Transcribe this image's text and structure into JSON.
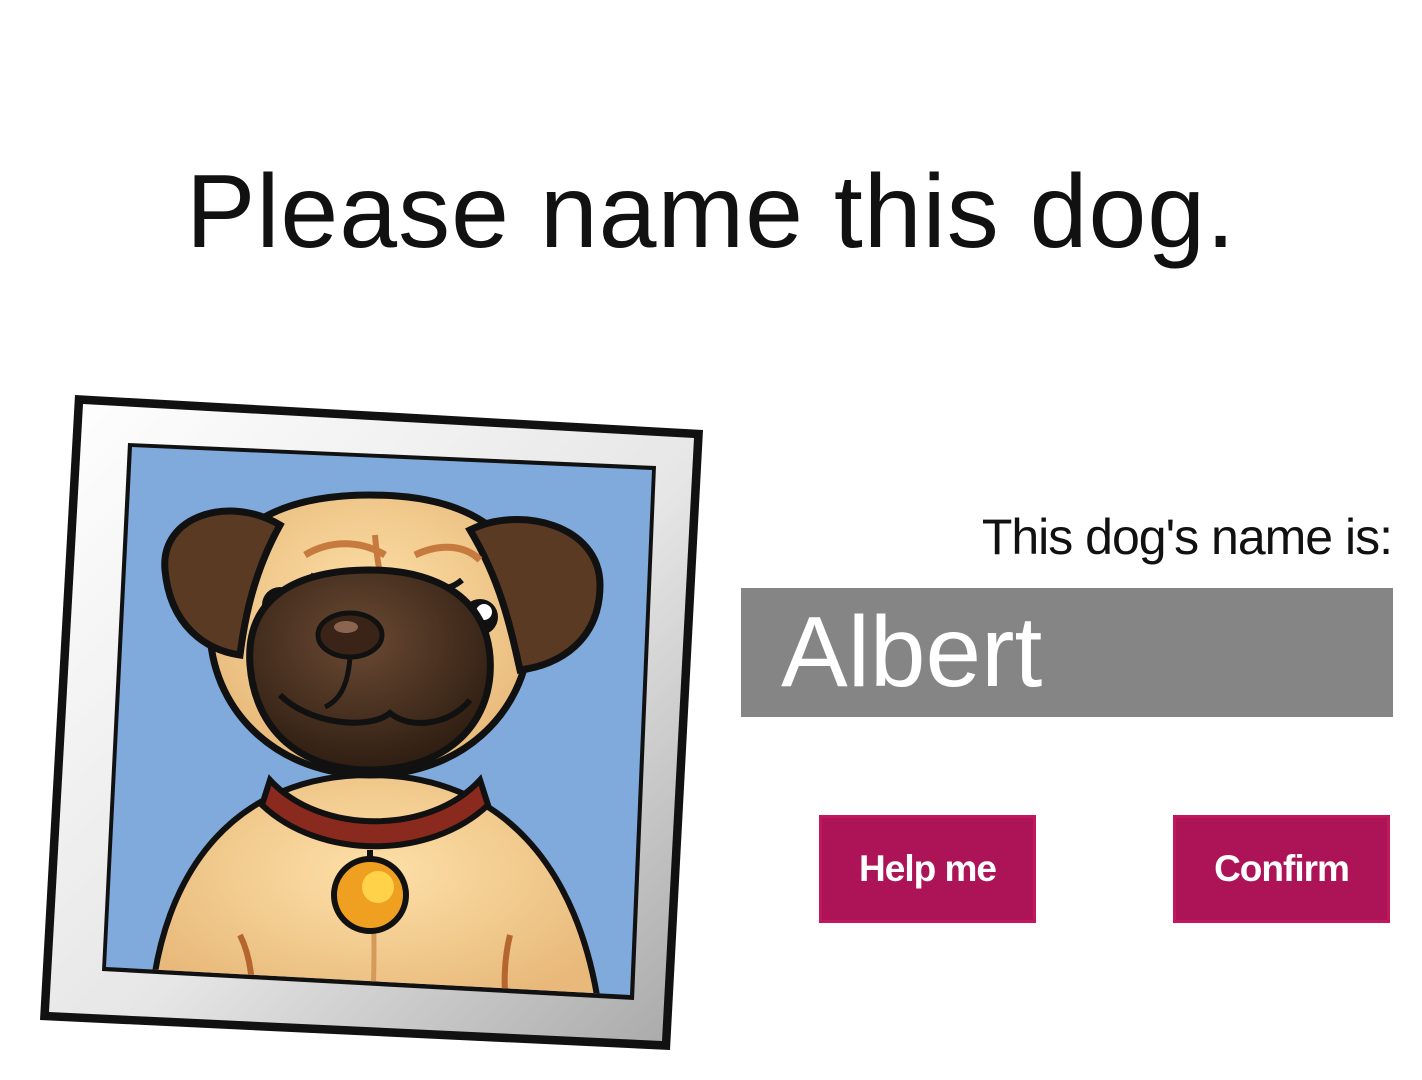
{
  "prompt": {
    "title": "Please name this dog."
  },
  "dog_photo": {
    "icon": "pug-dog-portrait-icon",
    "background_color": "#7faadb"
  },
  "name_form": {
    "label": "This dog's name is:",
    "name_value": "Albert"
  },
  "actions": {
    "help_label": "Help me",
    "confirm_label": "Confirm"
  },
  "colors": {
    "button_bg": "#ad1457",
    "input_bg": "#858585"
  }
}
